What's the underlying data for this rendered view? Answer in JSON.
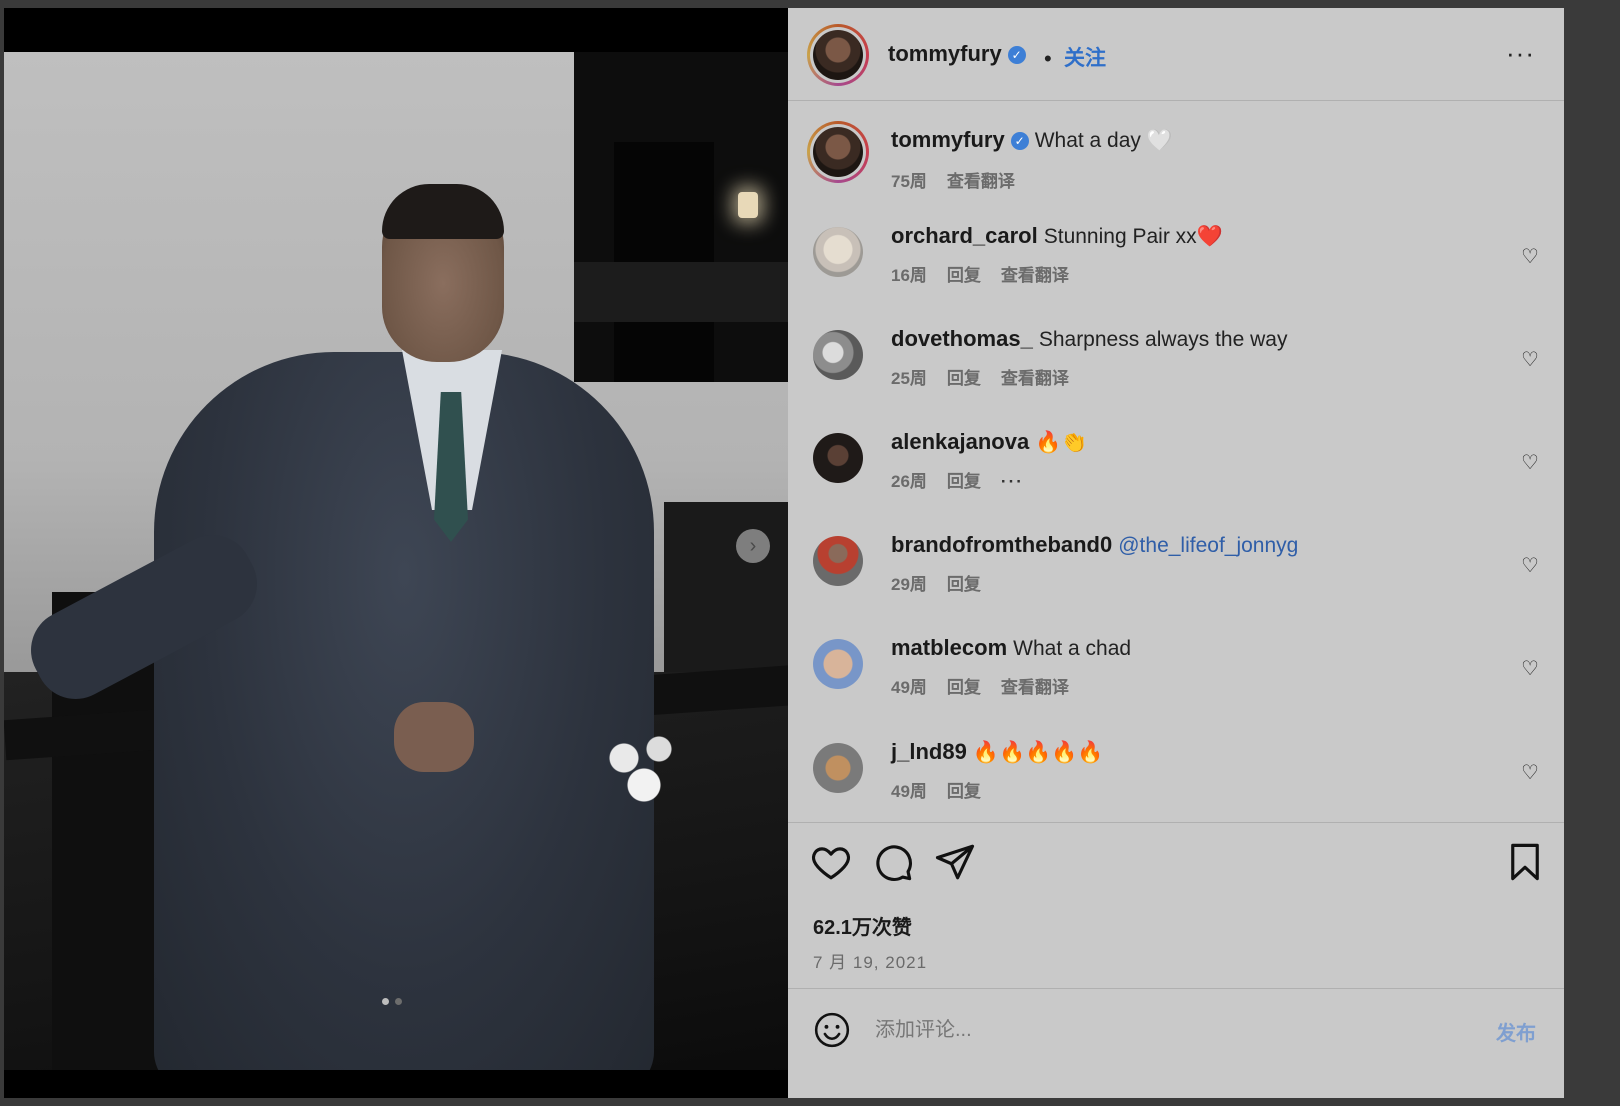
{
  "post": {
    "author": "tommyfury",
    "follow_label": "关注",
    "separator": "•",
    "more_label": "···",
    "verified_icon": "verified-badge-icon",
    "caption": {
      "username": "tommyfury",
      "text": "What a day 🤍",
      "age": "75周",
      "translate": "查看翻译"
    }
  },
  "comments": [
    {
      "username": "orchard_carol",
      "text": "Stunning Pair xx❤️",
      "age": "16周",
      "reply": "回复",
      "translate": "查看翻译"
    },
    {
      "username": "dovethomas_",
      "text": "Sharpness always the way",
      "age": "25周",
      "reply": "回复",
      "translate": "查看翻译"
    },
    {
      "username": "alenkajanova",
      "text": "🔥👏",
      "age": "26周",
      "reply": "回复",
      "more": "···"
    },
    {
      "username": "brandofromtheband0",
      "mention": "@the_lifeof_jonnyg",
      "age": "29周",
      "reply": "回复"
    },
    {
      "username": "matblecom",
      "text": "What a chad",
      "age": "49周",
      "reply": "回复",
      "translate": "查看翻译"
    },
    {
      "username": "j_lnd89",
      "text": "🔥🔥🔥🔥🔥",
      "age": "49周",
      "reply": "回复"
    }
  ],
  "actions": {
    "likes": "62.1万次赞",
    "date": "7 月 19, 2021",
    "icons": [
      "heart-icon",
      "comment-icon",
      "share-icon",
      "bookmark-icon"
    ]
  },
  "composer": {
    "placeholder": "添加评论...",
    "post_label": "发布"
  },
  "carousel": {
    "next_symbol": "›"
  }
}
